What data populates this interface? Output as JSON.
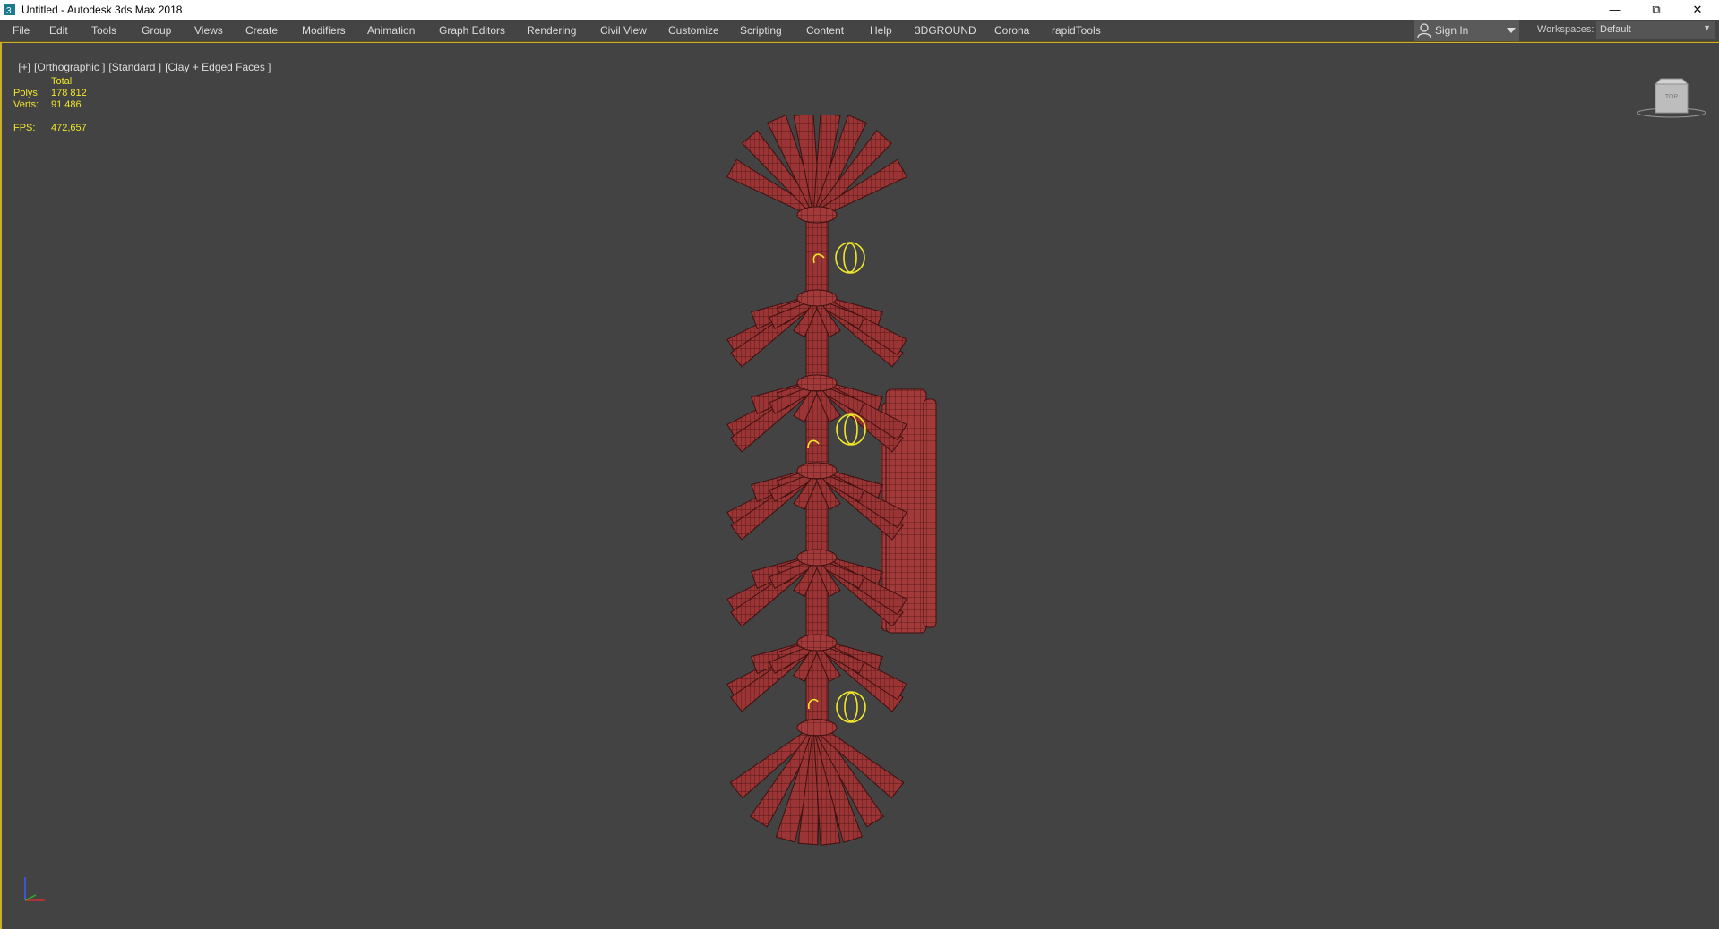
{
  "window": {
    "title": "Untitled - Autodesk 3ds Max 2018"
  },
  "menu": {
    "items": [
      "File",
      "Edit",
      "Tools",
      "Group",
      "Views",
      "Create",
      "Modifiers",
      "Animation",
      "Graph Editors",
      "Rendering",
      "Civil View",
      "Customize",
      "Scripting",
      "Content",
      "Help",
      "3DGROUND",
      "Corona",
      "rapidTools"
    ]
  },
  "account": {
    "signin_label": "Sign In"
  },
  "workspaces": {
    "label": "Workspaces:",
    "value": "Default"
  },
  "viewport": {
    "labels": [
      "[+]",
      "[Orthographic ]",
      "[Standard ]",
      "[Clay + Edged Faces ]"
    ],
    "stats": {
      "total_label": "Total",
      "polys_label": "Polys:",
      "polys_value": "178 812",
      "verts_label": "Verts:",
      "verts_value": "91 486",
      "fps_label": "FPS:",
      "fps_value": "472,657"
    },
    "viewcube_label": "TOP"
  },
  "colors": {
    "accent": "#cbb12b",
    "model": "#a33a3a",
    "wire": "#4a1414",
    "light": "#f2e62c"
  },
  "icons": [
    "app-icon",
    "minimize-icon",
    "restore-icon",
    "close-icon",
    "user-icon",
    "chevron-down-icon",
    "viewcube-icon",
    "axis-tripod-icon"
  ]
}
